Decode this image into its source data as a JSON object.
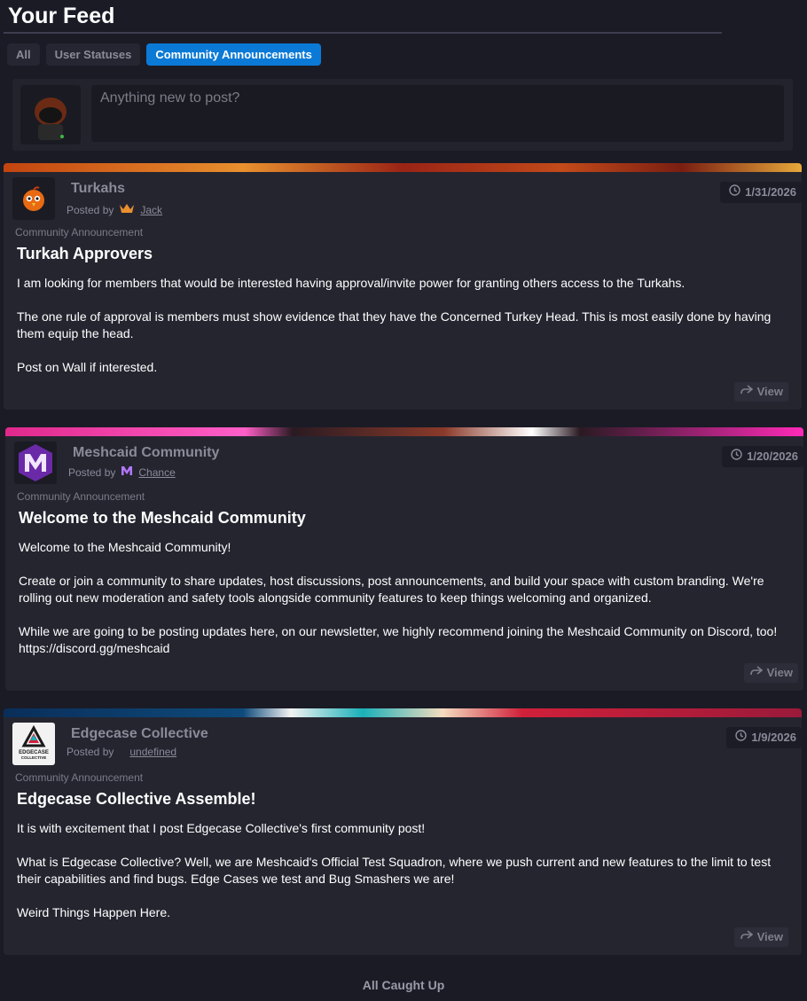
{
  "header": {
    "title": "Your Feed"
  },
  "tabs": [
    {
      "label": "All",
      "active": false
    },
    {
      "label": "User Statuses",
      "active": false
    },
    {
      "label": "Community Announcements",
      "active": true
    }
  ],
  "composer": {
    "placeholder": "Anything new to post?"
  },
  "posts": [
    {
      "community": "Turkahs",
      "posted_by_label": "Posted by",
      "author": "Jack",
      "date": "1/31/2026",
      "kind": "Community Announcement",
      "title": "Turkah Approvers",
      "body": [
        "I am looking for members that would be interested having approval/invite power for granting others access to the Turkahs.",
        "The one rule of approval is members must show evidence that they have the Concerned Turkey Head. This is most easily done by having them equip the head.",
        "Post on Wall if interested."
      ],
      "view_label": "View",
      "icon": "turkey-icon",
      "banner_colors": [
        "#c84a12",
        "#e9912c",
        "#8a1f14"
      ]
    },
    {
      "community": "Meshcaid Community",
      "posted_by_label": "Posted by",
      "author": "Chance",
      "date": "1/20/2026",
      "kind": "Community Announcement",
      "title": "Welcome to the Meshcaid Community",
      "body": [
        "Welcome to the Meshcaid Community!",
        "Create or join a community to share updates, host discussions, post announcements, and build your space with custom branding. We're rolling out new moderation and safety tools alongside community features to keep things welcoming and organized.",
        "While we are going to be posting updates here, on our newsletter, we highly recommend joining the Meshcaid Community on Discord, too! https://discord.gg/meshcaid"
      ],
      "view_label": "View",
      "icon": "meshcaid-m-icon",
      "banner_colors": [
        "#e0288c",
        "#ff4fc4",
        "#7a2a3a"
      ]
    },
    {
      "community": "Edgecase Collective",
      "posted_by_label": "Posted by",
      "author": "undefined",
      "date": "1/9/2026",
      "kind": "Community Announcement",
      "title": "Edgecase Collective Assemble!",
      "body": [
        "It is with excitement that I post Edgecase Collective's first community post!",
        "What is Edgecase Collective? Well, we are Meshcaid's Official Test Squadron, where we push current and new features to the limit to test their capabilities and find bugs. Edge Cases we test and Bug Smashers we are!",
        "Weird Things Happen Here."
      ],
      "view_label": "View",
      "icon": "edgecase-logo-icon",
      "icon_text": [
        "EDGECASE",
        "COLLECTIVE"
      ],
      "banner_colors": [
        "#0a3a6b",
        "#2aa6b0",
        "#d0203a"
      ]
    }
  ],
  "footer": {
    "status": "All Caught Up"
  },
  "colors": {
    "accent": "#0b7ad6",
    "background": "#1b1b26",
    "card": "#252530"
  }
}
